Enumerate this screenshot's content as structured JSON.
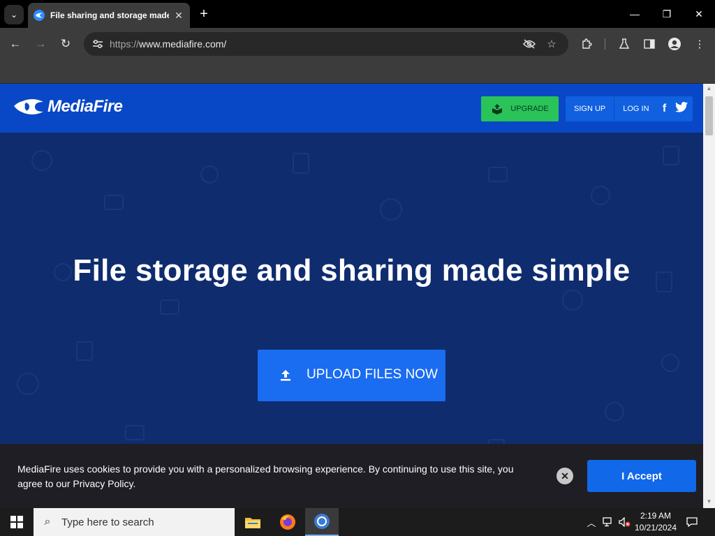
{
  "browser": {
    "tab_title": "File sharing and storage made simple",
    "tab_close": "✕",
    "new_tab": "+",
    "url_scheme": "https://",
    "url_rest": "www.mediafire.com/",
    "window_minimize": "—",
    "window_restore": "❐",
    "window_close": "✕"
  },
  "header": {
    "logo_text": "MediaFire",
    "upgrade_label": "UPGRADE",
    "signup_label": "SIGN UP",
    "login_label": "LOG IN",
    "facebook_glyph": "f",
    "twitter_glyph": "t"
  },
  "hero": {
    "title": "File storage and sharing made simple",
    "upload_label": "UPLOAD FILES NOW"
  },
  "cookie": {
    "text": "MediaFire uses cookies to provide you with a personalized browsing experience. By continuing to use this site, you agree to our Privacy Policy.",
    "close_glyph": "✕",
    "accept_label": "I Accept"
  },
  "taskbar": {
    "search_placeholder": "Type here to search",
    "time": "2:19 AM",
    "date": "10/21/2024"
  },
  "colors": {
    "header_blue": "#0847c5",
    "hero_navy": "#0f2c6f",
    "upgrade_green": "#29c35a",
    "accent_blue": "#1a6cf0"
  },
  "icons": [
    "tab-search-icon",
    "back-icon",
    "forward-icon",
    "reload-icon",
    "site-info-icon",
    "eye-off-icon",
    "star-icon",
    "extensions-icon",
    "labs-icon",
    "side-panel-icon",
    "profile-icon",
    "menu-icon",
    "upgrade-icon",
    "facebook-icon",
    "twitter-icon",
    "upload-icon",
    "windows-icon",
    "file-explorer-icon",
    "firefox-icon",
    "chrome-icon",
    "chevron-up-icon",
    "network-icon",
    "volume-muted-icon",
    "notification-icon"
  ]
}
